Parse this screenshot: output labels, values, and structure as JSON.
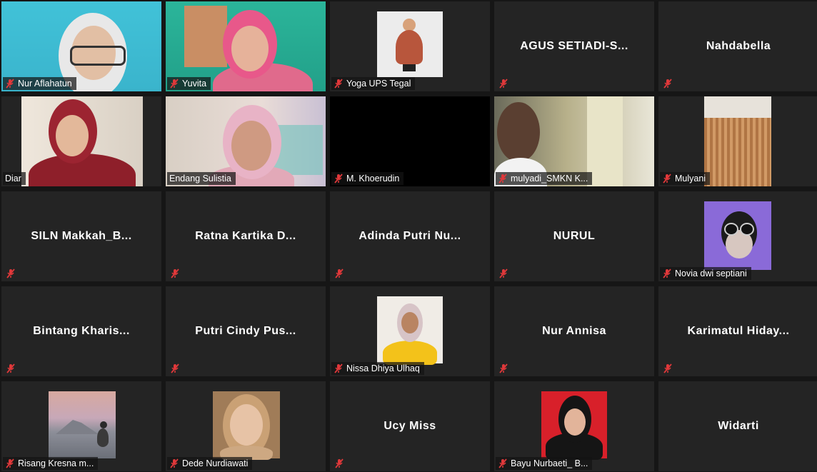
{
  "participants": [
    {
      "name": "Nur Aflahatun",
      "center_label": ""
    },
    {
      "name": "Yuvita",
      "center_label": ""
    },
    {
      "name": "Yoga UPS Tegal",
      "center_label": ""
    },
    {
      "name": "",
      "center_label": "AGUS  SETIADI-S..."
    },
    {
      "name": "",
      "center_label": "Nahdabella"
    },
    {
      "name": "Diar",
      "center_label": ""
    },
    {
      "name": "Endang Sulistia",
      "center_label": ""
    },
    {
      "name": "M. Khoerudin",
      "center_label": ""
    },
    {
      "name": "mulyadi_SMKN K...",
      "center_label": ""
    },
    {
      "name": "Mulyani",
      "center_label": ""
    },
    {
      "name": "",
      "center_label": "SILN  Makkah_B..."
    },
    {
      "name": "",
      "center_label": "Ratna  Kartika  D..."
    },
    {
      "name": "",
      "center_label": "Adinda  Putri  Nu..."
    },
    {
      "name": "",
      "center_label": "NURUL"
    },
    {
      "name": "Novia dwi septiani",
      "center_label": ""
    },
    {
      "name": "",
      "center_label": "Bintang  Kharis..."
    },
    {
      "name": "",
      "center_label": "Putri  Cindy  Pus..."
    },
    {
      "name": "Nissa Dhiya Ulhaq",
      "center_label": ""
    },
    {
      "name": "",
      "center_label": "Nur Annisa"
    },
    {
      "name": "",
      "center_label": "Karimatul  Hiday..."
    },
    {
      "name": "Risang Kresna m...",
      "center_label": ""
    },
    {
      "name": "Dede Nurdiawati",
      "center_label": ""
    },
    {
      "name": "",
      "center_label": "Ucy Miss"
    },
    {
      "name": "Bayu Nurbaeti_ B...",
      "center_label": ""
    },
    {
      "name": "",
      "center_label": "Widarti"
    }
  ],
  "colors": {
    "background": "#161616",
    "tile": "#242424",
    "active_speaker_border": "#d6e15a",
    "muted_icon": "#e0383a"
  },
  "icons": {
    "muted": "microphone-muted-icon"
  }
}
